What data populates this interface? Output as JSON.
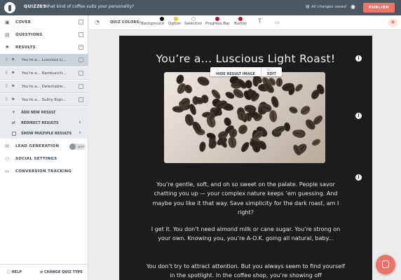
{
  "topbar": {
    "section": "QUIZZES",
    "separator": "›",
    "quiz_title": "What kind of coffee suits your personality?",
    "saved_status": "All changes saved",
    "publish_label": "PUBLISH"
  },
  "sidebar": {
    "cover": "COVER",
    "questions": "QUESTIONS",
    "results": "RESULTS",
    "result_items": [
      {
        "label": "You're a... Luscious Li..."
      },
      {
        "label": "You're a... Rambuncti..."
      },
      {
        "label": "You're a... Delectable..."
      },
      {
        "label": "You're a... Sultry Espr..."
      }
    ],
    "add_result": "ADD NEW RESULT",
    "redirect": "REDIRECT RESULTS",
    "show_multiple": "SHOW MULTIPLE RESULTS",
    "lead_generation": "LEAD GENERATION",
    "toggle_state": "OFF",
    "social": "SOCIAL SETTINGS",
    "conversion": "CONVERSION TRACKING",
    "help": "HELP",
    "change_type": "CHANGE QUIZ TYPE"
  },
  "colorbar": {
    "label": "QUIZ COLORS:",
    "swatches": [
      {
        "label": "Background",
        "color": "#111111"
      },
      {
        "label": "Option",
        "color": "#f2c81e"
      },
      {
        "label": "Selection",
        "color": "#ffffff"
      },
      {
        "label": "Progress Bar",
        "color": "#b3122b"
      },
      {
        "label": "Button",
        "color": "#b3122b"
      }
    ]
  },
  "result": {
    "title": "You’re a... Luscious Light Roast!",
    "hide_image": "HIDE RESULT IMAGE",
    "edit": "EDIT",
    "paragraphs": [
      "You’re gentle, soft, and oh so sweet on the palate. People savor chatting you up — your complex nature keeps ’em guessing. And maybe you like it that way. Save simplicity for the dark roast, am I right?",
      "I get it. You don’t need almond milk or cane sugar. You’re strong on your own. Knowing you, you’re A-O.K. going all natural, baby...",
      "You don’t try to attract attention. But you always seem to find yourself in the spotlight. In the coffee shop, you’re showing off"
    ]
  },
  "icons": {
    "info": "i"
  }
}
